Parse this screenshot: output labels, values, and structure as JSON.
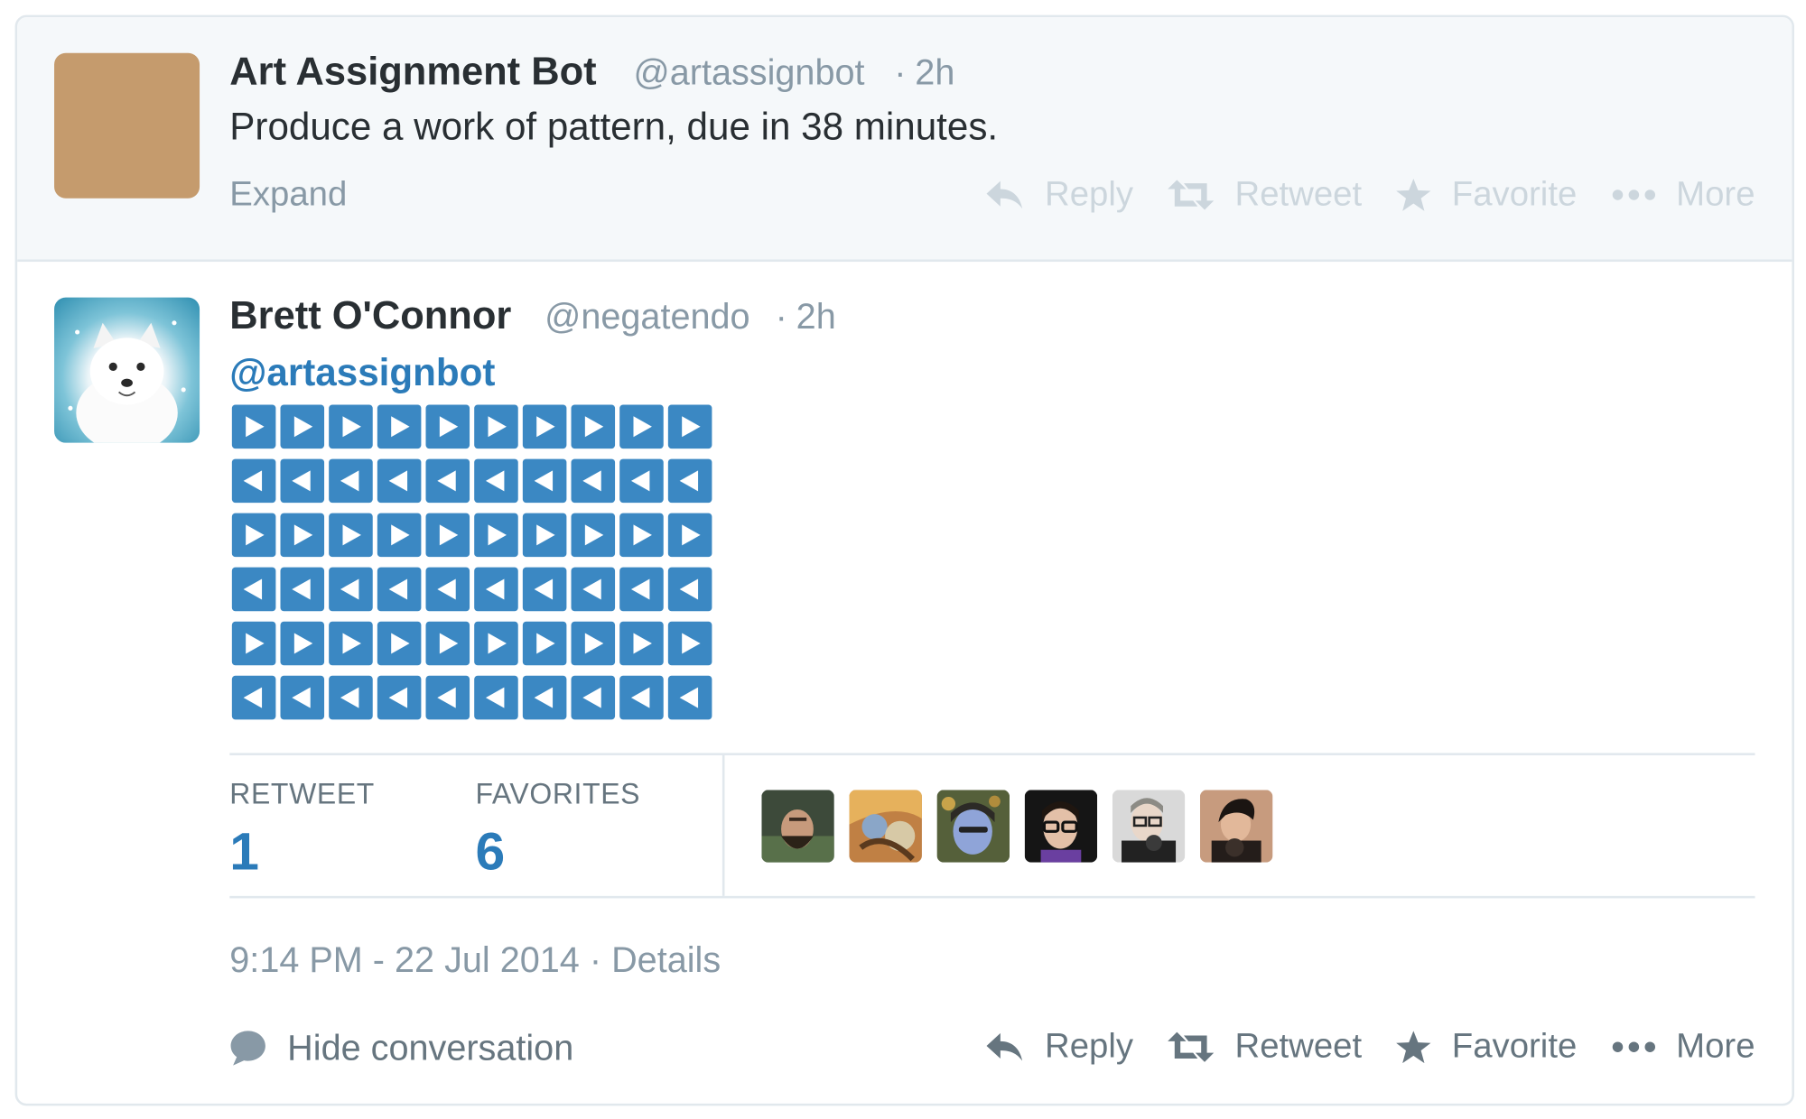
{
  "parent_tweet": {
    "author_name": "Art Assignment Bot",
    "handle": "@artassignbot",
    "time_sep": "·",
    "time": "2h",
    "text": "Produce a work of pattern, due in 38 minutes.",
    "expand_label": "Expand",
    "avatar_color": "#c59b6d",
    "actions": {
      "reply": "Reply",
      "retweet": "Retweet",
      "favorite": "Favorite",
      "more": "More"
    }
  },
  "main_tweet": {
    "author_name": "Brett O'Connor",
    "handle": "@negatendo",
    "time_sep": "·",
    "time": "2h",
    "mention": "@artassignbot",
    "pattern": {
      "rows": [
        "right",
        "left",
        "right",
        "left",
        "right",
        "left"
      ],
      "per_row": 10,
      "emoji_color": "#3b88c3"
    },
    "stats": {
      "retweet_label": "RETWEET",
      "retweet_count": "1",
      "favorites_label": "FAVORITES",
      "favorites_count": "6",
      "favoriter_avatars": [
        "favoriter-1",
        "favoriter-2",
        "favoriter-3",
        "favoriter-4",
        "favoriter-5",
        "favoriter-6"
      ]
    },
    "timestamp": "9:14 PM - 22 Jul 2014",
    "timestamp_sep": "·",
    "details_label": "Details",
    "hide_conversation_label": "Hide conversation",
    "actions": {
      "reply": "Reply",
      "retweet": "Retweet",
      "favorite": "Favorite",
      "more": "More"
    }
  },
  "colors": {
    "link_blue": "#2b7bb9",
    "muted_text": "#8899a6",
    "faded_action": "#ccd6dd",
    "action_text": "#66757f",
    "parent_bg": "#f5f8fa",
    "border": "#e1e8ed"
  }
}
